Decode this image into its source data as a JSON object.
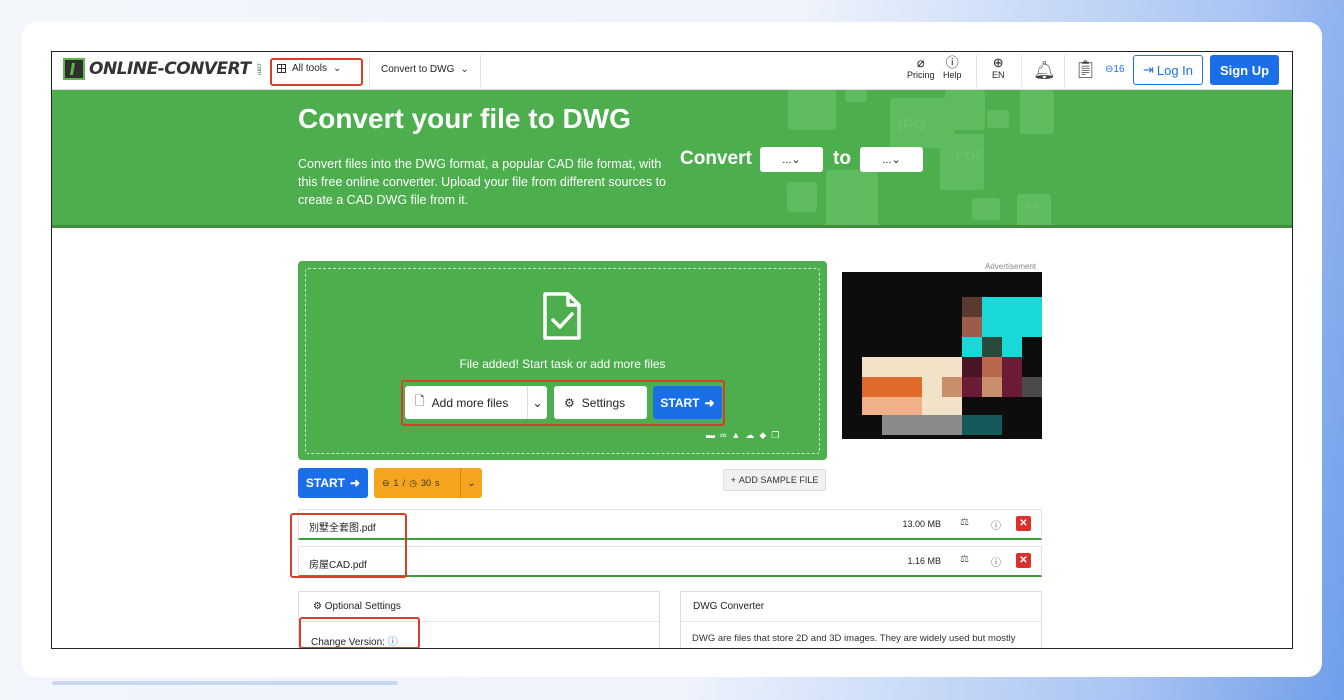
{
  "header": {
    "logo_text": "ONLINE-CONVERT",
    "logo_sub": ".com",
    "all_tools": "All tools",
    "convert_to": "Convert to DWG",
    "pricing": "Pricing",
    "help": "Help",
    "language": "EN",
    "credits": "16",
    "login": "Log In",
    "signup": "Sign Up"
  },
  "hero": {
    "title": "Convert your file to DWG",
    "description": "Convert files into the DWG format, a popular CAD file format, with this free online converter. Upload your file from different sources to create a CAD DWG file from it.",
    "convert_label": "Convert",
    "from_value": "...",
    "to_label": "to",
    "to_value": "...",
    "deco_labels": [
      "JPG",
      "PDF",
      "Aa"
    ]
  },
  "upload": {
    "status": "File added! Start task or add more files",
    "add_more": "Add more files",
    "settings": "Settings",
    "start": "START"
  },
  "ad": {
    "label": "Advertisement"
  },
  "controls": {
    "start": "START",
    "credit_cost": "1",
    "credit_sep": "/",
    "time": "30",
    "time_unit": "s",
    "add_sample": "ADD SAMPLE FILE"
  },
  "files": [
    {
      "name": "別墅全套图.pdf",
      "size": "13.00 MB"
    },
    {
      "name": "房屋CAD.pdf",
      "size": "1.16 MB"
    }
  ],
  "optional_settings": {
    "title": "Optional Settings",
    "change_version": "Change Version:"
  },
  "dwg_panel": {
    "title": "DWG Converter",
    "text": "DWG are files that store 2D and 3D images. They are widely used but mostly"
  },
  "colors": {
    "brand_green": "#4cae4c",
    "primary_blue": "#1a6fe8",
    "credit_orange": "#f5a41d",
    "delete_red": "#d9322e",
    "highlight_red": "#d5402b"
  }
}
